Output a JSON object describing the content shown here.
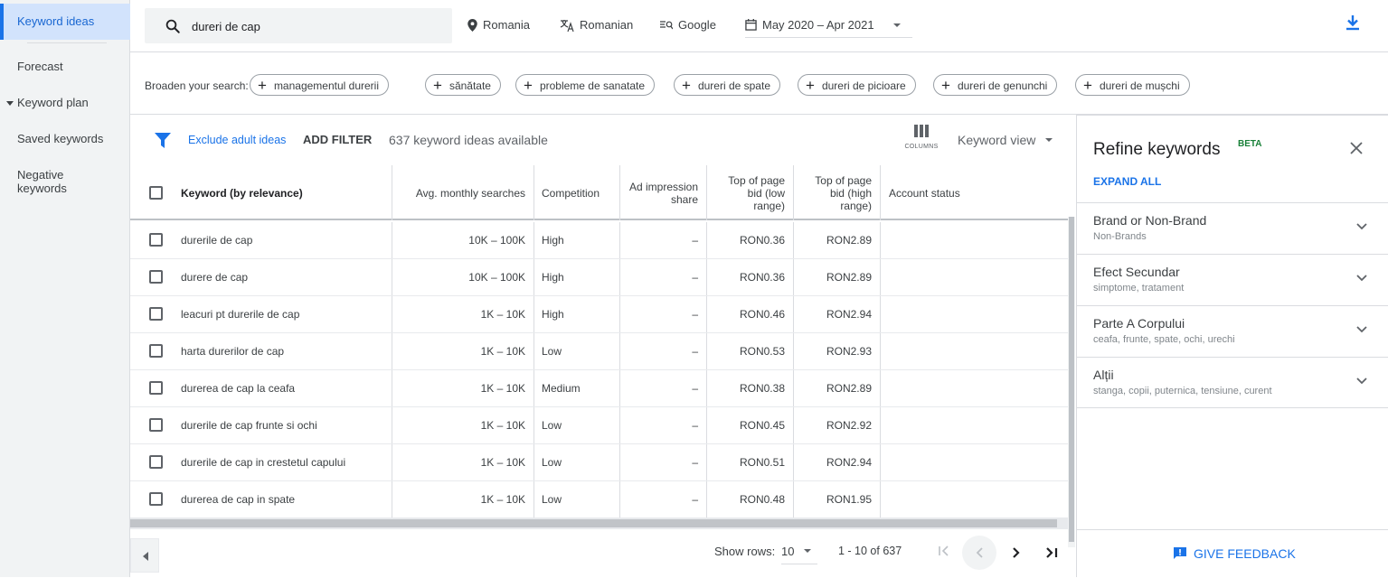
{
  "sidebar": {
    "items": [
      {
        "label": "Keyword ideas",
        "active": true
      },
      {
        "label": "Forecast"
      },
      {
        "label": "Keyword plan"
      },
      {
        "label": "Saved keywords"
      },
      {
        "label": "Negative keywords"
      }
    ]
  },
  "topbar": {
    "search_value": "dureri de cap",
    "location": "Romania",
    "language": "Romanian",
    "network": "Google",
    "date_range": "May 2020 – Apr 2021"
  },
  "broaden": {
    "label": "Broaden your search:",
    "chips": [
      "managementul durerii",
      "sănătate",
      "probleme de sanatate",
      "dureri de spate",
      "dureri de picioare",
      "dureri de genunchi",
      "dureri de mușchi"
    ]
  },
  "filter": {
    "exclude_label": "Exclude adult ideas",
    "add_filter": "ADD FILTER",
    "count_text": "637 keyword ideas available",
    "columns_label": "COLUMNS",
    "view_label": "Keyword view"
  },
  "table": {
    "headers": [
      "Keyword (by relevance)",
      "Avg. monthly searches",
      "Competition",
      "Ad impression share",
      "Top of page bid (low range)",
      "Top of page bid (high range)",
      "Account status"
    ],
    "rows": [
      {
        "keyword": "durerile de cap",
        "searches": "10K – 100K",
        "competition": "High",
        "impression": "–",
        "low": "RON0.36",
        "high": "RON2.89"
      },
      {
        "keyword": "durere de cap",
        "searches": "10K – 100K",
        "competition": "High",
        "impression": "–",
        "low": "RON0.36",
        "high": "RON2.89"
      },
      {
        "keyword": "leacuri pt durerile de cap",
        "searches": "1K – 10K",
        "competition": "High",
        "impression": "–",
        "low": "RON0.46",
        "high": "RON2.94"
      },
      {
        "keyword": "harta durerilor de cap",
        "searches": "1K – 10K",
        "competition": "Low",
        "impression": "–",
        "low": "RON0.53",
        "high": "RON2.93"
      },
      {
        "keyword": "durerea de cap la ceafa",
        "searches": "1K – 10K",
        "competition": "Medium",
        "impression": "–",
        "low": "RON0.38",
        "high": "RON2.89"
      },
      {
        "keyword": "durerile de cap frunte si ochi",
        "searches": "1K – 10K",
        "competition": "Low",
        "impression": "–",
        "low": "RON0.45",
        "high": "RON2.92"
      },
      {
        "keyword": "durerile de cap in crestetul capului",
        "searches": "1K – 10K",
        "competition": "Low",
        "impression": "–",
        "low": "RON0.51",
        "high": "RON2.94"
      },
      {
        "keyword": "durerea de cap in spate",
        "searches": "1K – 10K",
        "competition": "Low",
        "impression": "–",
        "low": "RON0.48",
        "high": "RON1.95"
      }
    ]
  },
  "pagination": {
    "show_rows_label": "Show rows:",
    "rows_value": "10",
    "range_text": "1 - 10 of 637"
  },
  "refine": {
    "title": "Refine keywords",
    "beta": "BETA",
    "expand_all": "EXPAND ALL",
    "sections": [
      {
        "title": "Brand or Non-Brand",
        "subtitle": "Non-Brands"
      },
      {
        "title": "Efect Secundar",
        "subtitle": "simptome, tratament"
      },
      {
        "title": "Parte A Corpului",
        "subtitle": "ceafa, frunte, spate, ochi, urechi"
      },
      {
        "title": "Alții",
        "subtitle": "stanga, copii, puternica, tensiune, curent"
      }
    ],
    "feedback": "GIVE FEEDBACK"
  },
  "colors": {
    "accent": "#1a73e8",
    "sidebar_bg": "#f1f3f4",
    "active_bg": "#d2e3fc",
    "beta": "#188038"
  }
}
